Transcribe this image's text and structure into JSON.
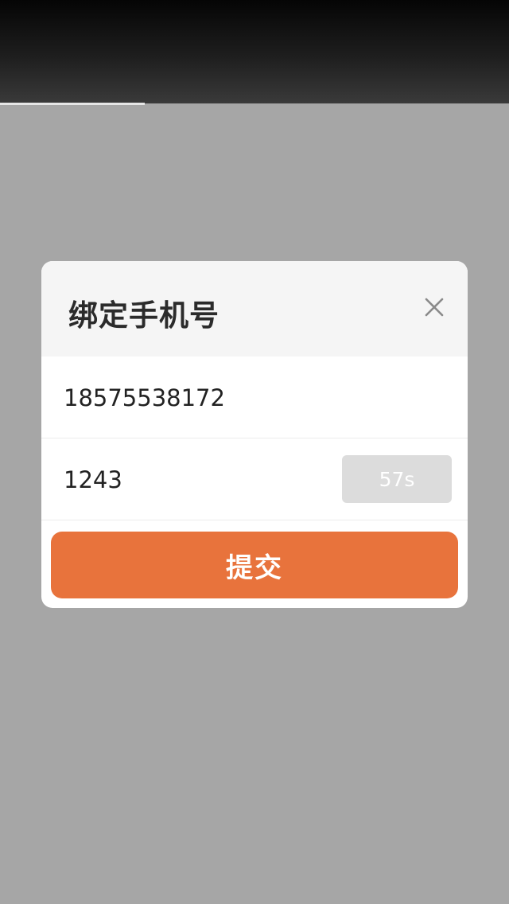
{
  "page_load": {
    "progress_fraction": 0.285
  },
  "dialog": {
    "title": "绑定手机号",
    "close_icon": "close-icon",
    "phone_field": {
      "value": "18575538172"
    },
    "code_field": {
      "value": "1243"
    },
    "code_button_label": "57s",
    "submit_label": "提交"
  },
  "colors": {
    "accent": "#e8733c",
    "header_bg": "#f5f5f5",
    "overlay": "#a6a6a6",
    "code_button_bg": "#dcdcdc"
  }
}
